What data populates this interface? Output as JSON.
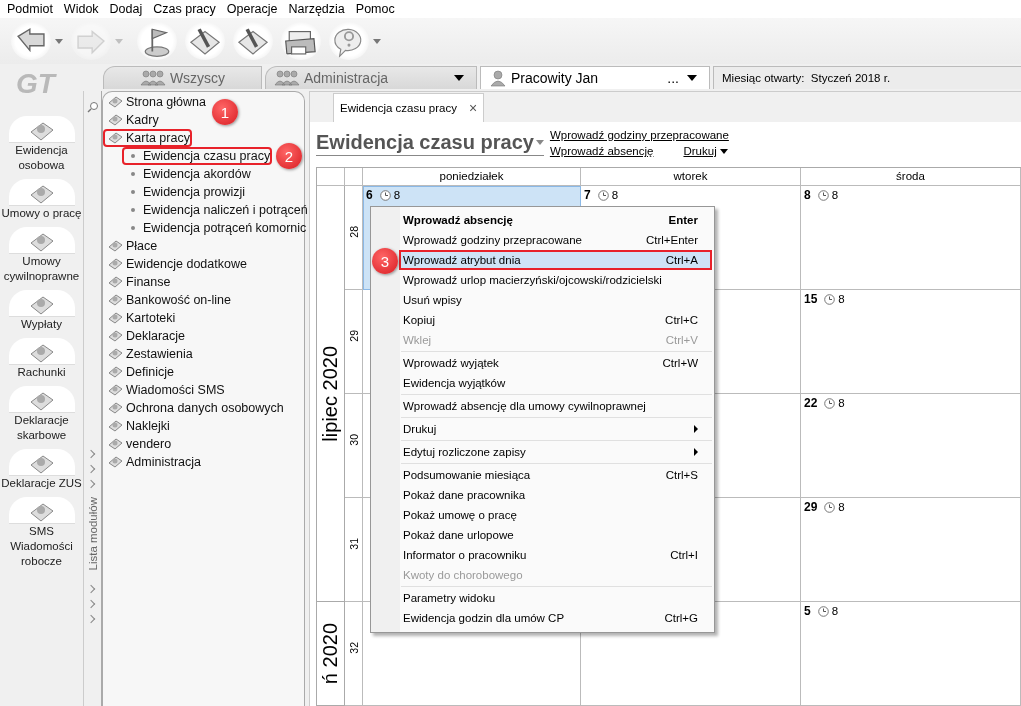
{
  "menu_bar": [
    "Podmiot",
    "Widok",
    "Dodaj",
    "Czas pracy",
    "Operacje",
    "Narzędzia",
    "Pomoc"
  ],
  "toolbar": [
    {
      "kind": "back",
      "dropdown": true,
      "disabled": false
    },
    {
      "kind": "forward",
      "dropdown": true,
      "disabled": true
    },
    {
      "kind": "flag",
      "dropdown": false,
      "disabled": false
    },
    {
      "kind": "pen",
      "dropdown": false,
      "disabled": false
    },
    {
      "kind": "pen",
      "dropdown": false,
      "disabled": false
    },
    {
      "kind": "printer",
      "dropdown": false,
      "disabled": false
    },
    {
      "kind": "help",
      "dropdown": true,
      "disabled": false
    }
  ],
  "logo": "GT",
  "modules": [
    {
      "label": "Ewidencja\nosobowa"
    },
    {
      "label": "Umowy o pracę"
    },
    {
      "label": "Umowy\ncywilnoprawne"
    },
    {
      "label": "Wypłaty"
    },
    {
      "label": "Rachunki"
    },
    {
      "label": "Deklaracje\nskarbowe"
    },
    {
      "label": "Deklaracje ZUS"
    },
    {
      "label": "SMS\nWiadomości\nrobocze"
    }
  ],
  "module_strip": {
    "label": "Lista modułów"
  },
  "tabs": [
    {
      "kind": "group",
      "label": "Wszyscy",
      "dropdown": false,
      "selected": false
    },
    {
      "kind": "group",
      "label": "Administracja",
      "dropdown": true,
      "selected": false
    },
    {
      "kind": "person",
      "label": "Pracowity Jan",
      "more": "...",
      "dropdown": true,
      "selected": true
    },
    {
      "kind": "info",
      "label": "Miesiąc otwarty:  Styczeń 2018 r.",
      "dropdown": false
    }
  ],
  "tree": [
    {
      "label": "Strona główna",
      "highlighted": false
    },
    {
      "label": "Kadry",
      "highlighted": false
    },
    {
      "label": "Karta pracy",
      "highlighted": true,
      "children": [
        {
          "label": "Ewidencja czasu pracy",
          "highlighted": true
        },
        {
          "label": "Ewidencja akordów",
          "highlighted": false
        },
        {
          "label": "Ewidencja prowizji",
          "highlighted": false
        },
        {
          "label": "Ewidencja naliczeń i potrąceń",
          "highlighted": false
        },
        {
          "label": "Ewidencja potrąceń komornic",
          "highlighted": false
        }
      ]
    },
    {
      "label": "Płace",
      "highlighted": false
    },
    {
      "label": "Ewidencje dodatkowe",
      "highlighted": false
    },
    {
      "label": "Finanse",
      "highlighted": false
    },
    {
      "label": "Bankowość on-line",
      "highlighted": false
    },
    {
      "label": "Kartoteki",
      "highlighted": false
    },
    {
      "label": "Deklaracje",
      "highlighted": false
    },
    {
      "label": "Zestawienia",
      "highlighted": false
    },
    {
      "label": "Definicje",
      "highlighted": false
    },
    {
      "label": "Wiadomości SMS",
      "highlighted": false
    },
    {
      "label": "Ochrona danych osobowych",
      "highlighted": false
    },
    {
      "label": "Naklejki",
      "highlighted": false
    },
    {
      "label": "vendero",
      "highlighted": false
    },
    {
      "label": "Administracja",
      "highlighted": false
    }
  ],
  "annotations": [
    {
      "number": "1"
    },
    {
      "number": "2"
    },
    {
      "number": "3"
    }
  ],
  "document_tab": {
    "label": "Ewidencja czasu pracy",
    "close": "×",
    "selected": true
  },
  "view": {
    "title": "Ewidencja czasu pracy",
    "links": [
      "Wprowadź godziny przepracowane",
      "Wprowadź absencję"
    ],
    "print_link": "Drukuj"
  },
  "calendar": {
    "days": [
      "poniedziałek",
      "wtorek",
      "środa"
    ],
    "months": [
      {
        "label": "lipiec 2020",
        "weeks": [
          {
            "number": "28",
            "cells": [
              {
                "day": "6",
                "hours": "8",
                "selected": true
              },
              {
                "day": "7",
                "hours": "8",
                "selected": false
              },
              {
                "day": "8",
                "hours": "8",
                "selected": false
              }
            ]
          },
          {
            "number": "29",
            "cells": [
              {
                "selected": false
              },
              {
                "selected": false
              },
              {
                "day": "15",
                "hours": "8",
                "selected": false
              }
            ]
          },
          {
            "number": "30",
            "cells": [
              {
                "selected": false
              },
              {
                "selected": false
              },
              {
                "day": "22",
                "hours": "8",
                "selected": false
              }
            ]
          },
          {
            "number": "31",
            "cells": [
              {
                "selected": false
              },
              {
                "selected": false
              },
              {
                "day": "29",
                "hours": "8",
                "selected": false
              }
            ]
          }
        ]
      },
      {
        "label": "ń 2020",
        "weeks": [
          {
            "number": "32",
            "cells": [
              {
                "selected": false
              },
              {
                "selected": false
              },
              {
                "day": "5",
                "hours": "8",
                "selected": false
              }
            ]
          }
        ]
      }
    ]
  },
  "context_menu": {
    "groups": [
      [
        {
          "label": "Wprowadź absencję",
          "shortcut": "Enter",
          "default": true,
          "disabled": false,
          "submenu": false,
          "selected": false,
          "highlighted": false
        },
        {
          "label": "Wprowadź godziny przepracowane",
          "shortcut": "Ctrl+Enter",
          "default": false,
          "disabled": false,
          "submenu": false,
          "selected": false,
          "highlighted": false
        },
        {
          "label": "Wprowadź atrybut dnia",
          "shortcut": "Ctrl+A",
          "default": false,
          "disabled": false,
          "submenu": false,
          "selected": true,
          "highlighted": true
        },
        {
          "label": "Wprowadź urlop macierzyński/ojcowski/rodzicielski",
          "default": false,
          "disabled": false,
          "submenu": false,
          "selected": false,
          "highlighted": false
        },
        {
          "label": "Usuń wpisy",
          "default": false,
          "disabled": false,
          "submenu": false,
          "selected": false,
          "highlighted": false
        },
        {
          "label": "Kopiuj",
          "shortcut": "Ctrl+C",
          "default": false,
          "disabled": false,
          "submenu": false,
          "selected": false,
          "highlighted": false
        },
        {
          "label": "Wklej",
          "shortcut": "Ctrl+V",
          "default": false,
          "disabled": true,
          "submenu": false,
          "selected": false,
          "highlighted": false
        }
      ],
      [
        {
          "label": "Wprowadź wyjątek",
          "shortcut": "Ctrl+W",
          "default": false,
          "disabled": false,
          "submenu": false,
          "selected": false,
          "highlighted": false
        },
        {
          "label": "Ewidencja wyjątków",
          "default": false,
          "disabled": false,
          "submenu": false,
          "selected": false,
          "highlighted": false
        }
      ],
      [
        {
          "label": "Wprowadź absencję dla umowy cywilnoprawnej",
          "default": false,
          "disabled": false,
          "submenu": false,
          "selected": false,
          "highlighted": false
        }
      ],
      [
        {
          "label": "Drukuj",
          "default": false,
          "disabled": false,
          "submenu": true,
          "selected": false,
          "highlighted": false
        }
      ],
      [
        {
          "label": "Edytuj rozliczone zapisy",
          "default": false,
          "disabled": false,
          "submenu": true,
          "selected": false,
          "highlighted": false
        }
      ],
      [
        {
          "label": "Podsumowanie miesiąca",
          "shortcut": "Ctrl+S",
          "default": false,
          "disabled": false,
          "submenu": false,
          "selected": false,
          "highlighted": false
        },
        {
          "label": "Pokaż dane pracownika",
          "default": false,
          "disabled": false,
          "submenu": false,
          "selected": false,
          "highlighted": false
        },
        {
          "label": "Pokaż umowę o pracę",
          "default": false,
          "disabled": false,
          "submenu": false,
          "selected": false,
          "highlighted": false
        },
        {
          "label": "Pokaż dane urlopowe",
          "default": false,
          "disabled": false,
          "submenu": false,
          "selected": false,
          "highlighted": false
        },
        {
          "label": "Informator o pracowniku",
          "shortcut": "Ctrl+I",
          "default": false,
          "disabled": false,
          "submenu": false,
          "selected": false,
          "highlighted": false
        },
        {
          "label": "Kwoty do chorobowego",
          "default": false,
          "disabled": true,
          "submenu": false,
          "selected": false,
          "highlighted": false
        }
      ],
      [
        {
          "label": "Parametry widoku",
          "default": false,
          "disabled": false,
          "submenu": false,
          "selected": false,
          "highlighted": false
        },
        {
          "label": "Ewidencja godzin dla umów CP",
          "shortcut": "Ctrl+G",
          "default": false,
          "disabled": false,
          "submenu": false,
          "selected": false,
          "highlighted": false
        }
      ]
    ]
  }
}
